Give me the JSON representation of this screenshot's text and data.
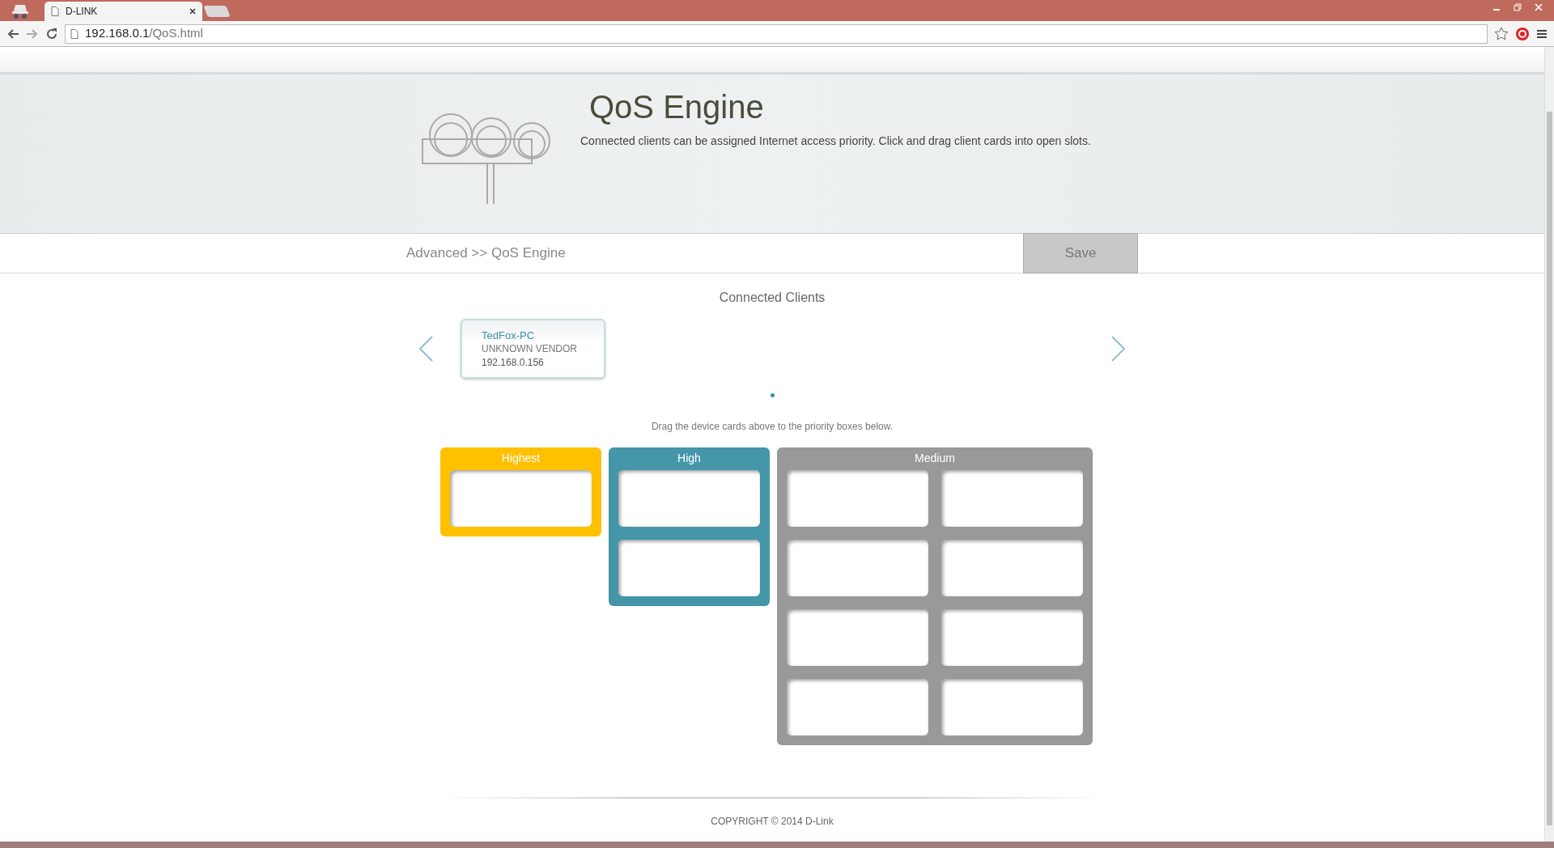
{
  "browser": {
    "tab_title": "D-LINK",
    "url_host": "192.168.0.1",
    "url_path": "/QoS.html"
  },
  "header": {
    "title": "QoS Engine",
    "description": "Connected clients can be assigned Internet access priority. Click and drag client cards into open slots."
  },
  "breadcrumb": "Advanced >> QoS Engine",
  "save_button": {
    "label": "Save",
    "disabled": true
  },
  "connected_clients": {
    "title": "Connected Clients",
    "clients": [
      {
        "name": "TedFox-PC",
        "vendor": "UNKNOWN VENDOR",
        "ip": "192.168.0.156"
      }
    ],
    "pages": [
      {
        "selected": true
      }
    ],
    "hint": "Drag the device cards above to the priority boxes below."
  },
  "priority_groups": [
    {
      "label": "Highest",
      "color": "#ffc000",
      "kind": "single",
      "slots": [
        {
          "filled": false
        }
      ]
    },
    {
      "label": "High",
      "color": "#4496a8",
      "kind": "single",
      "slots": [
        {
          "filled": false
        },
        {
          "filled": false
        }
      ]
    },
    {
      "label": "Medium",
      "color": "#999999",
      "kind": "double",
      "slots": [
        {
          "filled": false
        },
        {
          "filled": false
        },
        {
          "filled": false
        },
        {
          "filled": false
        },
        {
          "filled": false
        },
        {
          "filled": false
        },
        {
          "filled": false
        },
        {
          "filled": false
        }
      ]
    }
  ],
  "footer": "COPYRIGHT © 2014 D-Link"
}
